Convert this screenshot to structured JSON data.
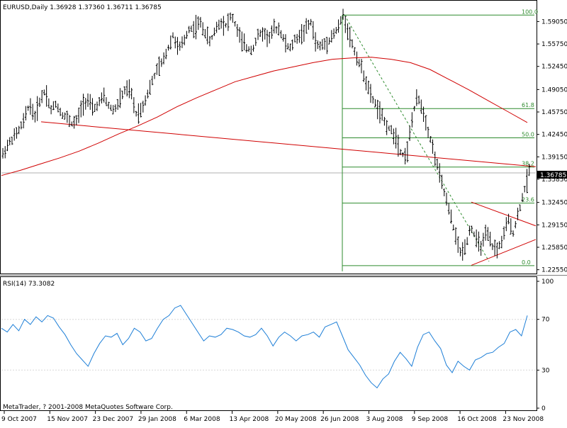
{
  "header": {
    "symbol_line": "EURUSD,Daily  1.36928 1.37360 1.36711 1.36785"
  },
  "copyright": "MetaTrader, ? 2001-2008 MetaQuotes Software Corp.",
  "price_badge": "1.36785",
  "colors": {
    "bars": "#000000",
    "ma_line": "#d00000",
    "trend_line": "#d00000",
    "fib_line": "#2e8b2e",
    "rsi_line": "#1e7fd7",
    "dashed_line": "#2e8b2e",
    "grid_level": "#b0b0b0"
  },
  "chart_data": [
    {
      "type": "line",
      "title": "EURUSD,Daily",
      "ohlc_readout": {
        "open": 1.36928,
        "high": 1.3736,
        "low": 1.36711,
        "close": 1.36785
      },
      "y_tick_labels": [
        "1.59050",
        "1.55750",
        "1.52450",
        "1.49050",
        "1.45750",
        "1.42450",
        "1.39150",
        "1.35850",
        "1.32450",
        "1.29150",
        "1.25850",
        "1.22550"
      ],
      "y_ticks": [
        1.5905,
        1.5575,
        1.5245,
        1.4905,
        1.4575,
        1.4245,
        1.3915,
        1.3585,
        1.3245,
        1.2915,
        1.2585,
        1.2255
      ],
      "x_tick_labels": [
        "9 Oct 2007",
        "15 Nov 2007",
        "23 Dec 2007",
        "29 Jan 2008",
        "6 Mar 2008",
        "13 Apr 2008",
        "20 May 2008",
        "26 Jun 2008",
        "3 Aug 2008",
        "9 Sep 2008",
        "16 Oct 2008",
        "23 Nov 2008"
      ],
      "ylim": [
        1.222,
        1.618
      ],
      "close_series": [
        1.395,
        1.41,
        1.42,
        1.43,
        1.445,
        1.47,
        1.45,
        1.475,
        1.49,
        1.46,
        1.47,
        1.455,
        1.45,
        1.44,
        1.445,
        1.47,
        1.475,
        1.46,
        1.47,
        1.48,
        1.465,
        1.46,
        1.475,
        1.49,
        1.49,
        1.455,
        1.46,
        1.48,
        1.5,
        1.52,
        1.53,
        1.55,
        1.57,
        1.55,
        1.56,
        1.58,
        1.58,
        1.59,
        1.575,
        1.56,
        1.58,
        1.59,
        1.585,
        1.6,
        1.58,
        1.56,
        1.55,
        1.55,
        1.57,
        1.575,
        1.565,
        1.58,
        1.58,
        1.56,
        1.55,
        1.565,
        1.57,
        1.58,
        1.59,
        1.555,
        1.555,
        1.56,
        1.57,
        1.58,
        1.6,
        1.575,
        1.55,
        1.53,
        1.51,
        1.485,
        1.47,
        1.455,
        1.44,
        1.43,
        1.42,
        1.395,
        1.395,
        1.45,
        1.48,
        1.46,
        1.43,
        1.4,
        1.37,
        1.34,
        1.31,
        1.28,
        1.25,
        1.26,
        1.29,
        1.27,
        1.26,
        1.28,
        1.26,
        1.255,
        1.27,
        1.3,
        1.28,
        1.31,
        1.34,
        1.37
      ],
      "series": [
        {
          "name": "",
          "values": [
            1.364,
            1.372,
            1.381,
            1.39,
            1.4,
            1.412,
            1.425,
            1.437,
            1.45,
            1.465,
            1.478,
            1.49,
            1.502,
            1.51,
            1.518,
            1.524,
            1.53,
            1.535,
            1.537,
            1.538,
            1.535,
            1.53,
            1.52,
            1.505,
            1.49,
            1.474,
            1.458,
            1.442
          ]
        }
      ],
      "trend_line": {
        "from": 1.443,
        "to": 1.377
      },
      "fibonacci": {
        "levels": [
          {
            "label": "100.0",
            "price": 1.6
          },
          {
            "label": "61.8",
            "price": 1.4625
          },
          {
            "label": "50.0",
            "price": 1.4195
          },
          {
            "label": "38.2",
            "price": 1.3765
          },
          {
            "label": "23.6",
            "price": 1.3235
          },
          {
            "label": "0.0",
            "price": 1.2315
          }
        ]
      },
      "triangle": {
        "upper": [
          1.325,
          1.29
        ],
        "lower": [
          1.232,
          1.27
        ]
      },
      "last_price": 1.36785
    },
    {
      "type": "line",
      "title": "RSI(14) 73.3082",
      "y_ticks": [
        0,
        30,
        70,
        100
      ],
      "y_tick_labels": [
        "0",
        "30",
        "70",
        "100"
      ],
      "ylim": [
        0,
        100
      ],
      "series": [
        {
          "name": "RSI(14)",
          "values": [
            63,
            60,
            66,
            61,
            70,
            66,
            72,
            68,
            73,
            71,
            64,
            58,
            50,
            43,
            38,
            33,
            43,
            51,
            57,
            56,
            59,
            50,
            55,
            63,
            60,
            53,
            55,
            63,
            70,
            73,
            79,
            81,
            74,
            67,
            60,
            53,
            57,
            56,
            58,
            63,
            62,
            60,
            57,
            56,
            58,
            63,
            57,
            49,
            56,
            60,
            57,
            53,
            57,
            58,
            60,
            56,
            64,
            66,
            68,
            57,
            46,
            40,
            34,
            26,
            20,
            16,
            23,
            27,
            37,
            44,
            39,
            33,
            48,
            58,
            60,
            53,
            47,
            34,
            28,
            37,
            33,
            30,
            38,
            40,
            43,
            44,
            48,
            51,
            60,
            62,
            57,
            73
          ]
        }
      ]
    }
  ]
}
